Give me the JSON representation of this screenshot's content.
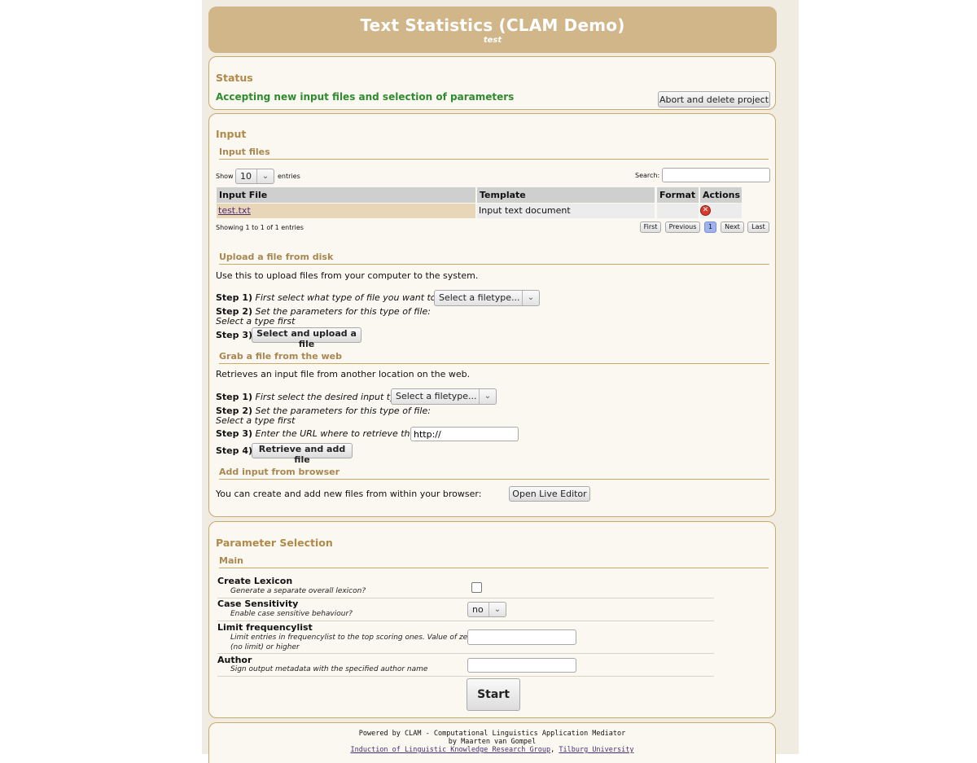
{
  "header": {
    "title": "Text Statistics (CLAM Demo)",
    "subtitle": "test"
  },
  "status": {
    "heading": "Status",
    "message": "Accepting new input files and selection of parameters",
    "abort_button": "Abort and delete project"
  },
  "input": {
    "heading": "Input",
    "files": {
      "heading": "Input files",
      "show_label": "Show",
      "show_value": "10",
      "entries_label": "entries",
      "search_label": "Search:",
      "columns": [
        "Input File",
        "Template",
        "Format",
        "Actions"
      ],
      "rows": [
        {
          "file": "test.txt",
          "template": "Input text document",
          "format": ""
        }
      ],
      "info": "Showing 1 to 1 of 1 entries",
      "pagination": {
        "first": "First",
        "previous": "Previous",
        "current": "1",
        "next": "Next",
        "last": "Last"
      }
    },
    "upload": {
      "heading": "Upload a file from disk",
      "desc": "Use this to upload files from your computer to the system.",
      "step1_label": "Step 1)",
      "step1_text": "First select what type of file you want to add:",
      "step1_select": "Select a filetype...",
      "step2_label": "Step 2)",
      "step2_text": "Set the parameters for this type of file:",
      "step2_note": "Select a type first",
      "step3_label": "Step 3)",
      "step3_button": "Select and upload a file"
    },
    "web": {
      "heading": "Grab a file from the web",
      "desc": "Retrieves an input file from another location on the web.",
      "step1_label": "Step 1)",
      "step1_text": "First select the desired input type:",
      "step1_select": "Select a filetype...",
      "step2_label": "Step 2)",
      "step2_text": "Set the parameters for this type of file:",
      "step2_note": "Select a type first",
      "step3_label": "Step 3)",
      "step3_text": "Enter the URL where to retrieve the file",
      "url_value": "http://",
      "step4_label": "Step 4)",
      "step4_button": "Retrieve and add file"
    },
    "browser": {
      "heading": "Add input from browser",
      "desc": "You can create and add new files from within your browser:",
      "button": "Open Live Editor"
    }
  },
  "parameters": {
    "heading": "Parameter Selection",
    "group": "Main",
    "create_lexicon": {
      "label": "Create Lexicon",
      "desc": "Generate a separate overall lexicon?",
      "checked": false
    },
    "case_sensitivity": {
      "label": "Case Sensitivity",
      "desc": "Enable case sensitive behaviour?",
      "value": "no"
    },
    "limit": {
      "label": "Limit frequencylist",
      "desc_line1": "Limit entries in frequencylist to the top scoring ones. Value of zero",
      "desc_line2": "(no limit) or higher",
      "value": ""
    },
    "author": {
      "label": "Author",
      "desc": "Sign output metadata with the specified author name",
      "value": ""
    },
    "start_button": "Start"
  },
  "footer": {
    "line1": "Powered by CLAM - Computational Linguistics Application Mediator",
    "line2": "by Maarten van Gompel",
    "link1": "Induction of Linguistic Knowledge Research Group",
    "sep": ", ",
    "link2": "Tilburg University"
  }
}
